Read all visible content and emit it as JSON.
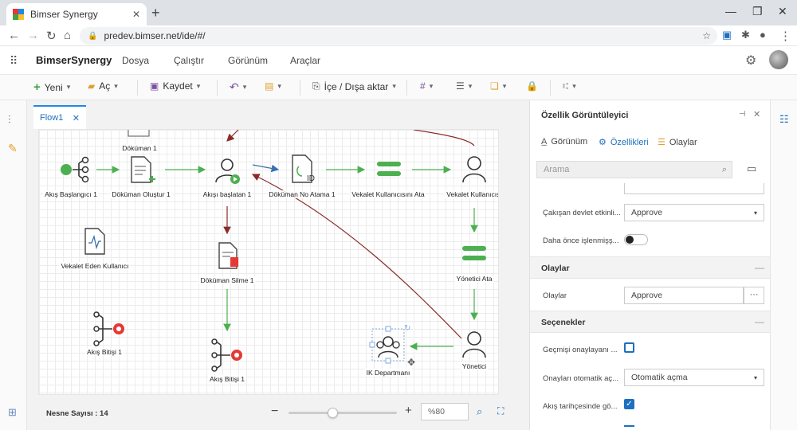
{
  "browser": {
    "tab_title": "Bimser Synergy",
    "url": "predev.bimser.net/ide/#/"
  },
  "app": {
    "brand": "BimserSynergy",
    "menu": [
      "Dosya",
      "Çalıştır",
      "Görünüm",
      "Araçlar"
    ]
  },
  "toolbar": {
    "new_label": "Yeni",
    "open_label": "Aç",
    "save_label": "Kaydet",
    "import_export_label": "İçe / Dışa aktar"
  },
  "document": {
    "tab_label": "Flow1"
  },
  "nodes": {
    "top_document": "Döküman 1",
    "flow_start": "Akış Başlangıcı 1",
    "create_document": "Döküman Oluştur 1",
    "start_flow": "Akışı başlatan 1",
    "doc_number": "Döküman No Atama 1",
    "assign_proxy": "Vekalet Kullanıcısını Ata",
    "proxy_user": "Vekalet Kullanıcısı",
    "proxy_giver": "Vekalet Eden Kullanıcı",
    "delete_document": "Döküman Silme 1",
    "assign_manager": "Yönetici Ata",
    "flow_end_left": "Akış Bitişi 1",
    "flow_end_mid": "Akış Bitişi 1",
    "hr_department": "IK Departmanı",
    "manager": "Yönetici"
  },
  "statusbar": {
    "object_count": "Nesne Sayısı : 14",
    "zoom_value": "%80",
    "zoom": 0.8
  },
  "properties": {
    "title": "Özellik Görüntüleyici",
    "tabs": [
      "Görünüm",
      "Özellikleri",
      "Olaylar"
    ],
    "search_placeholder": "Arama",
    "rows": {
      "conflict_label": "Çakışan devlet etkinli...",
      "conflict_value": "Approve",
      "processed_label": "Daha önce işlenmişş...",
      "events_section": "Olaylar",
      "events_label": "Olaylar",
      "events_value": "Approve",
      "options_section": "Seçenekler",
      "history_label": "Geçmişi onaylayanı ...",
      "auto_label": "Onayları otomatik aç...",
      "auto_value": "Otomatik açma",
      "flow_history_label": "Akış tarihçesinde gö..."
    }
  },
  "colors": {
    "accent": "#1e6fbf",
    "green": "#4caf50",
    "red": "#e53935",
    "arrow_dark_red": "#8b2a2a"
  }
}
